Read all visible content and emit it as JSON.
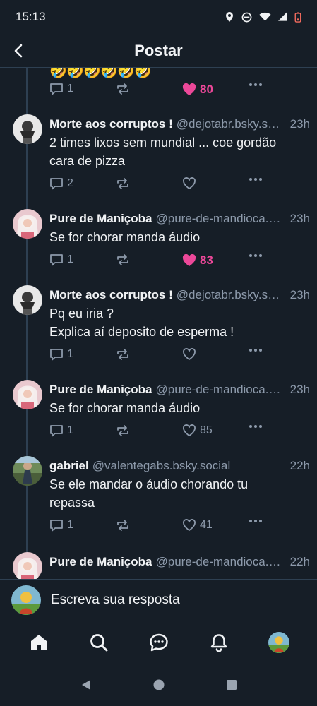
{
  "status_bar": {
    "time": "15:13"
  },
  "header": {
    "title": "Postar"
  },
  "prev_post": {
    "emojis": [
      "🤣",
      "🤣",
      "🤣",
      "🤣",
      "🤣",
      "🤣"
    ],
    "reply_count": "1",
    "like_count": "80"
  },
  "posts": [
    {
      "name": "Morte aos corruptos !",
      "handle": "@dejotabr.bsky.social",
      "time": "23h",
      "text": [
        "2 times lixos sem mundial ... coe gordão",
        "cara de pizza"
      ],
      "reply_count": "2",
      "like_count": ""
    },
    {
      "name": "Pure de Maniçoba",
      "handle": "@pure-de-mandioca.bsky.social",
      "time": "23h",
      "text": [
        "Se for chorar manda áudio"
      ],
      "reply_count": "1",
      "like_count": "83"
    },
    {
      "name": "Morte aos corruptos !",
      "handle": "@dejotabr.bsky.social",
      "time": "23h",
      "text": [
        "Pq eu iria ?",
        "Explica aí deposito de esperma !"
      ],
      "reply_count": "1",
      "like_count": ""
    },
    {
      "name": "Pure de Maniçoba",
      "handle": "@pure-de-mandioca.bsky.social",
      "time": "23h",
      "text": [
        "Se for chorar manda áudio"
      ],
      "reply_count": "1",
      "like_count": "85"
    },
    {
      "name": "gabriel",
      "handle": "@valentegabs.bsky.social",
      "time": "22h",
      "text": [
        "Se ele mandar o áudio chorando tu",
        "repassa"
      ],
      "reply_count": "1",
      "like_count": "41"
    },
    {
      "name": "Pure de Maniçoba",
      "handle": "@pure-de-mandioca.bsky.social",
      "time": "22h",
      "text": [
        ""
      ],
      "reply_count": "",
      "like_count": ""
    }
  ],
  "composer": {
    "placeholder": "Escreva sua resposta"
  },
  "icons": {
    "back": "chevron-left-icon",
    "reply": "speech-bubble-icon",
    "repost": "repost-arrows-icon",
    "like": "heart-icon",
    "more": "ellipsis-icon",
    "home": "home-icon",
    "search": "search-icon",
    "chat": "chat-icon",
    "notifications": "bell-icon"
  },
  "colors": {
    "background": "#161e27",
    "border": "#2e4052",
    "muted": "#8d9aab",
    "like": "#ec4899",
    "text": "#f1f3f5"
  }
}
